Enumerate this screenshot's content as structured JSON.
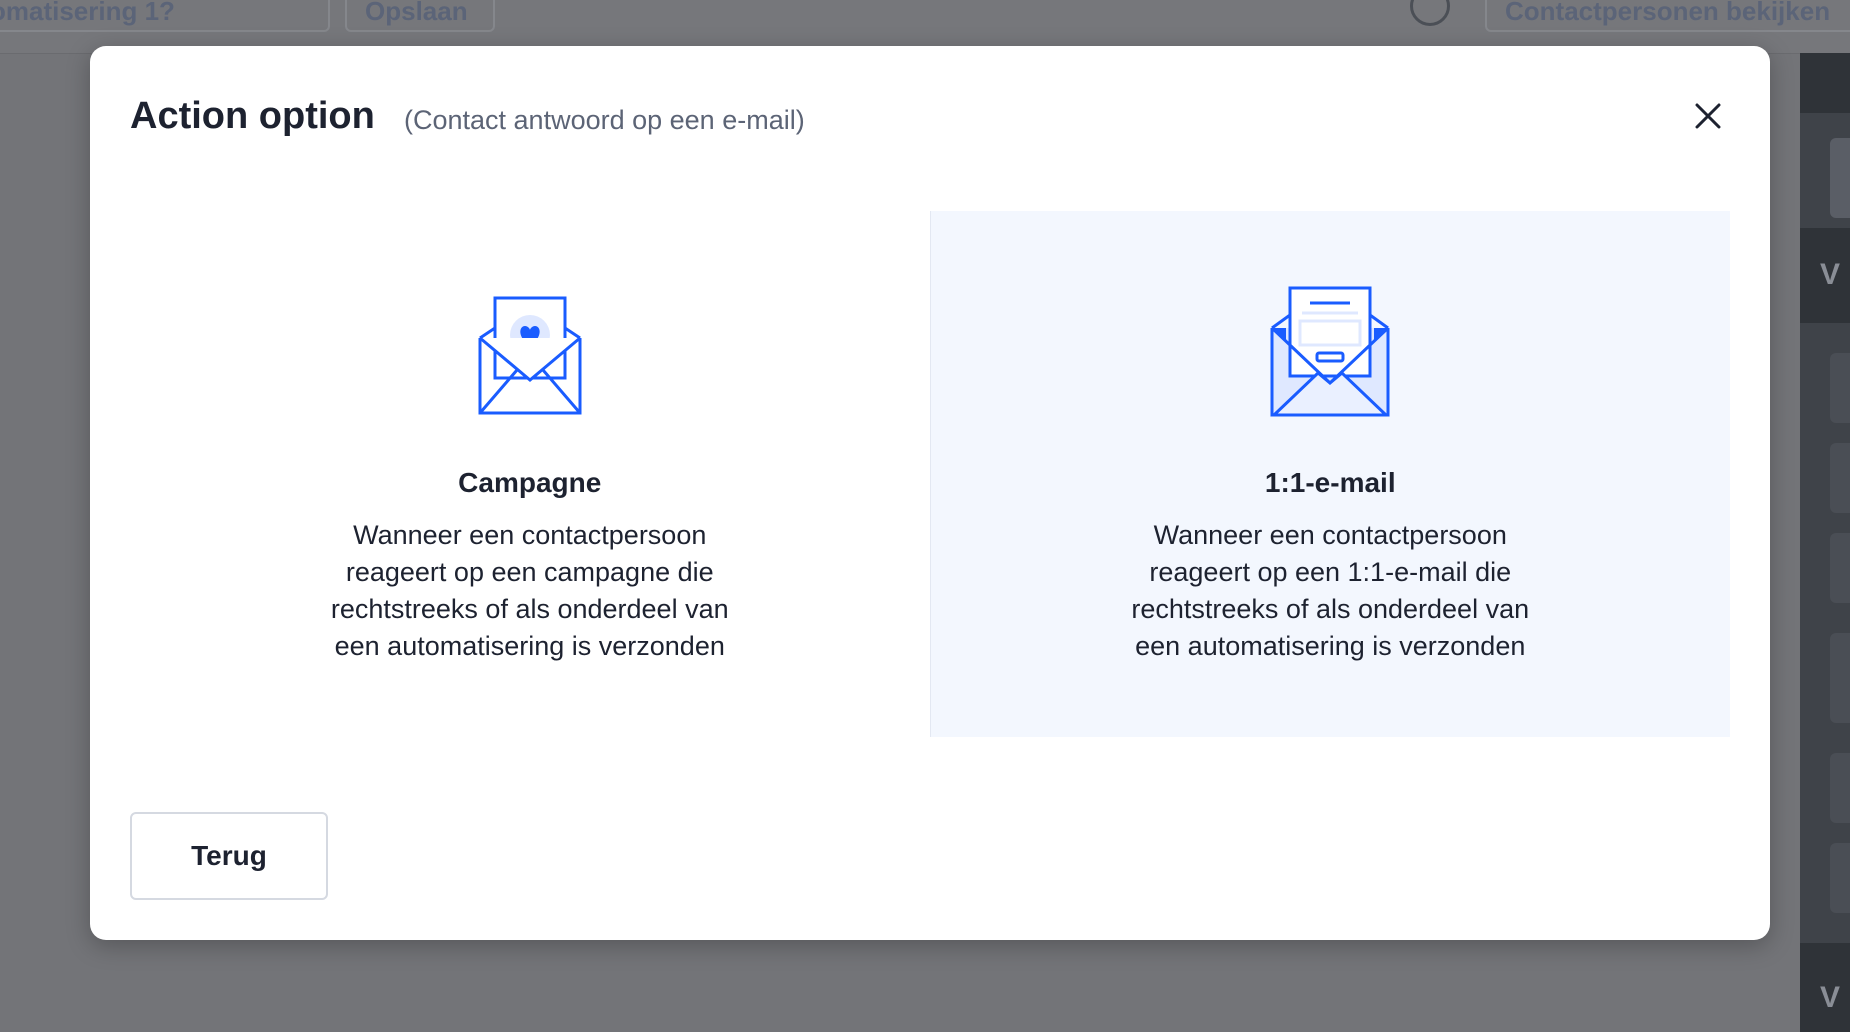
{
  "background": {
    "toolbar": {
      "left_button_label": "omatisering 1?",
      "second_button_label": "Opslaan",
      "right_button_label": "Contactpersonen bekijken"
    },
    "side_letters": [
      "V",
      "V"
    ]
  },
  "modal": {
    "title": "Action option",
    "subtitle": "(Contact antwoord op een e-mail)",
    "close_icon": "close-icon",
    "options": [
      {
        "icon": "envelope-heart-icon",
        "title": "Campagne",
        "description": "Wanneer een contactpersoon reageert op een campagne die rechtstreeks of als onderdeel van een automatisering is verzonden"
      },
      {
        "icon": "envelope-letter-icon",
        "title": "1:1-e-mail",
        "description": "Wanneer een contactpersoon reageert op een 1:1-e-mail die rechtstreeks of als onderdeel van een automatisering is verzonden"
      }
    ],
    "back_button_label": "Terug"
  },
  "colors": {
    "accent": "#1a5cff",
    "accent_light": "#dfe8ff",
    "highlight_bg": "#f3f7fe",
    "text": "#1d2230",
    "muted_text": "#5c6476"
  }
}
